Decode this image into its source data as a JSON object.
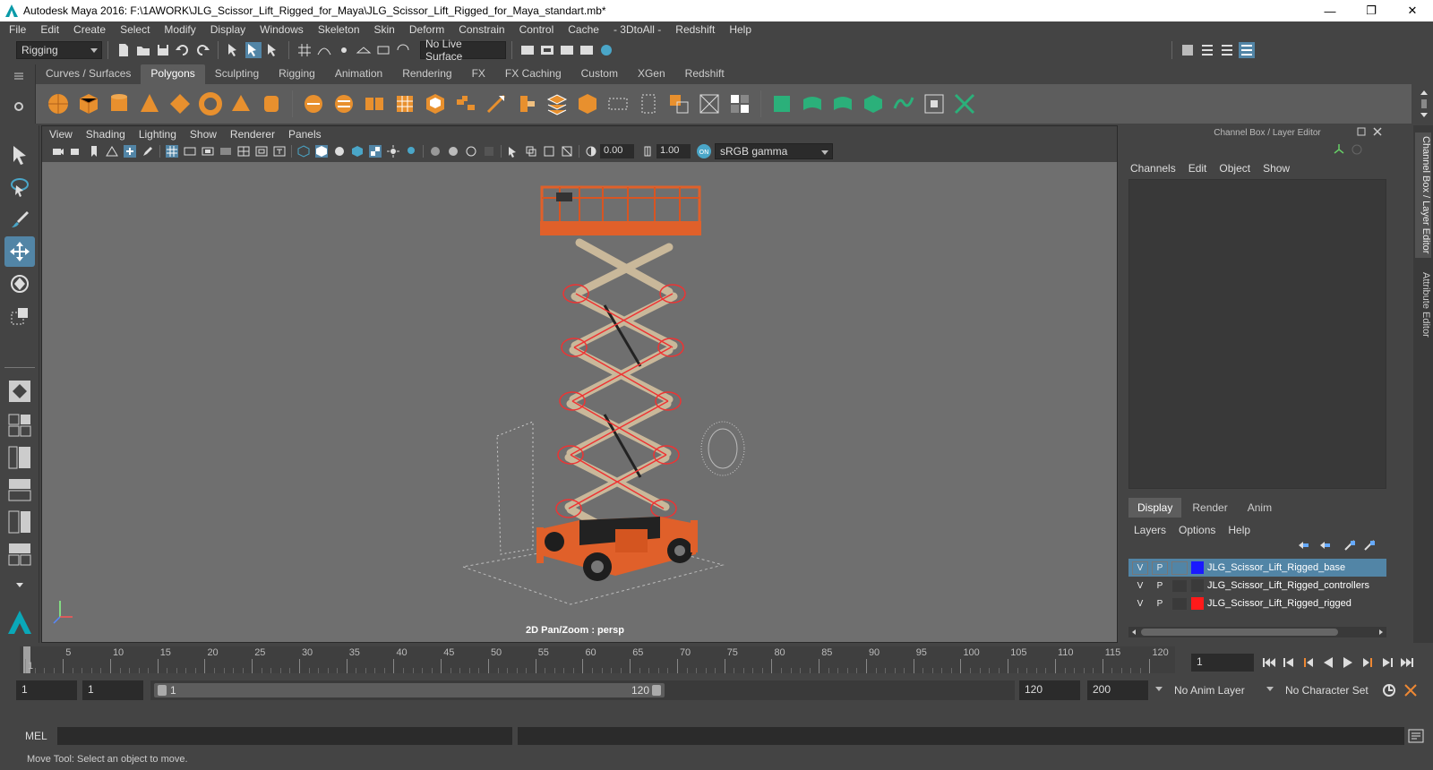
{
  "window": {
    "title": "Autodesk Maya 2016: F:\\1AWORK\\JLG_Scissor_Lift_Rigged_for_Maya\\JLG_Scissor_Lift_Rigged_for_Maya_standart.mb*",
    "minimize": "—",
    "restore": "❐",
    "close": "✕"
  },
  "menubar": [
    "File",
    "Edit",
    "Create",
    "Select",
    "Modify",
    "Display",
    "Windows",
    "Skeleton",
    "Skin",
    "Deform",
    "Constrain",
    "Control",
    "Cache",
    "- 3DtoAll -",
    "Redshift",
    "Help"
  ],
  "status": {
    "menuset": "Rigging",
    "live_surface": "No Live Surface"
  },
  "shelf": {
    "tabs": [
      "Curves / Surfaces",
      "Polygons",
      "Sculpting",
      "Rigging",
      "Animation",
      "Rendering",
      "FX",
      "FX Caching",
      "Custom",
      "XGen",
      "Redshift"
    ],
    "active_tab": "Polygons"
  },
  "viewport": {
    "menu": [
      "View",
      "Shading",
      "Lighting",
      "Show",
      "Renderer",
      "Panels"
    ],
    "exposure": "0.00",
    "gamma": "1.00",
    "color_space": "sRGB gamma",
    "label": "2D Pan/Zoom : persp"
  },
  "channel_box": {
    "title": "Channel Box / Layer Editor",
    "menu": [
      "Channels",
      "Edit",
      "Object",
      "Show"
    ],
    "side_tabs": [
      "Channel Box / Layer Editor",
      "Attribute Editor"
    ]
  },
  "layers": {
    "tabs": [
      "Display",
      "Render",
      "Anim"
    ],
    "active_tab": "Display",
    "menu": [
      "Layers",
      "Options",
      "Help"
    ],
    "rows": [
      {
        "v": "V",
        "p": "P",
        "color": "#1a1aff",
        "name": "JLG_Scissor_Lift_Rigged_base",
        "selected": true
      },
      {
        "v": "V",
        "p": "P",
        "color": "",
        "name": "JLG_Scissor_Lift_Rigged_controllers",
        "selected": false
      },
      {
        "v": "V",
        "p": "P",
        "color": "#ff1a1a",
        "name": "JLG_Scissor_Lift_Rigged_rigged",
        "selected": false
      }
    ]
  },
  "timeline": {
    "ticks": [
      "1",
      "5",
      "10",
      "15",
      "20",
      "25",
      "30",
      "35",
      "40",
      "45",
      "50",
      "55",
      "60",
      "65",
      "70",
      "75",
      "80",
      "85",
      "90",
      "95",
      "100",
      "105",
      "110",
      "115",
      "120"
    ],
    "current_frame": "1"
  },
  "range": {
    "start": "1",
    "anim_start": "1",
    "range_start": "1",
    "range_end": "120",
    "end": "120",
    "anim_end": "200",
    "anim_layer": "No Anim Layer",
    "character_set": "No Character Set"
  },
  "command": {
    "label": "MEL",
    "help": "Move Tool: Select an object to move."
  }
}
